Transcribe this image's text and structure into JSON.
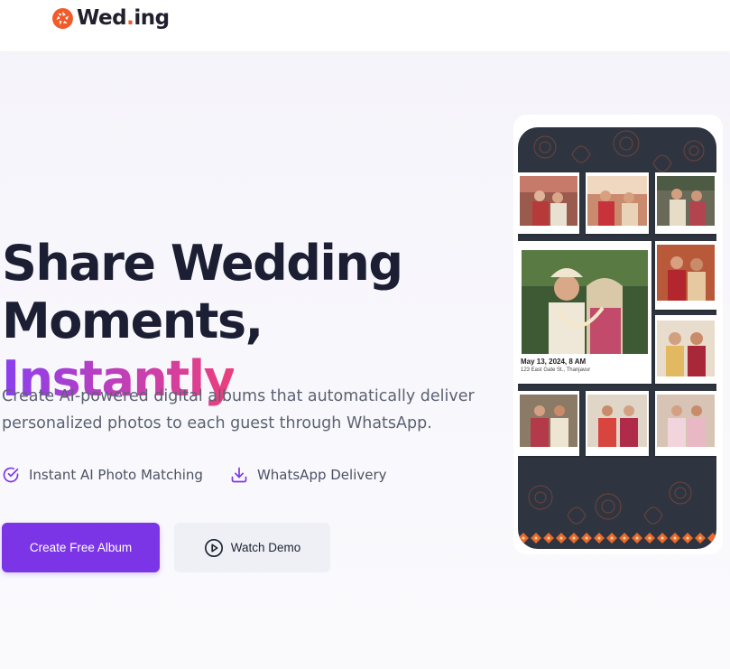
{
  "brand": {
    "name_prefix": "Wed",
    "name_dot": ".",
    "name_suffix": "ing",
    "icon": "camera-aperture-icon",
    "accent_color": "#f15a29"
  },
  "hero": {
    "headline_line1": "Share Wedding",
    "headline_line2_plain": "Moments, ",
    "headline_line2_accent": "Instantly",
    "subtitle_line1": "Create AI-powered digital albums that automatically deliver",
    "subtitle_line2": "personalized photos to each guest through WhatsApp.",
    "features": [
      {
        "label": "Instant AI Photo Matching",
        "icon": "check-circle-icon"
      },
      {
        "label": "WhatsApp Delivery",
        "icon": "download-icon"
      }
    ],
    "primary_button": "Create Free Album",
    "secondary_button": "Watch Demo",
    "secondary_icon": "play-circle-icon",
    "colors": {
      "primary": "#7b35e6",
      "headline": "#1c1f33",
      "gradient_start": "#8a3ff0",
      "gradient_end": "#ec3f7c"
    }
  },
  "phone_mockup": {
    "featured_photo_date": "May 13, 2024, 8 AM",
    "featured_photo_address": "123 East Gate St., Thanjavur",
    "photo_count": 10
  }
}
